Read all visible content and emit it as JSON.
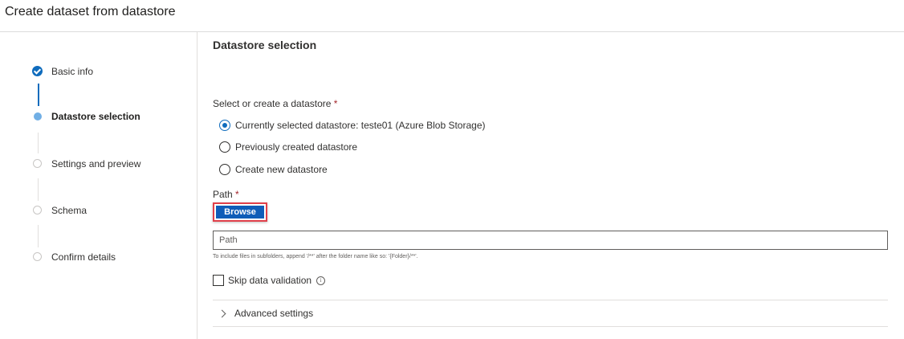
{
  "window": {
    "title": "Create dataset from datastore"
  },
  "steps": [
    {
      "label": "Basic info",
      "state": "complete"
    },
    {
      "label": "Datastore selection",
      "state": "current"
    },
    {
      "label": "Settings and preview",
      "state": "pending"
    },
    {
      "label": "Schema",
      "state": "pending"
    },
    {
      "label": "Confirm details",
      "state": "pending"
    }
  ],
  "main": {
    "section_title": "Datastore selection",
    "datastore_label": "Select or create a datastore",
    "required_mark": "*",
    "radio_options": [
      {
        "label": "Currently selected datastore: teste01 (Azure Blob Storage)",
        "selected": true
      },
      {
        "label": "Previously created datastore",
        "selected": false
      },
      {
        "label": "Create new datastore",
        "selected": false
      }
    ],
    "path_label": "Path",
    "browse_label": "Browse",
    "path_placeholder": "Path",
    "path_hint": "To include files in subfolders, append '/**' after the folder name like so: '{Folder}/**'.",
    "skip_validation_label": "Skip data validation",
    "skip_validation_checked": false,
    "info_icon": "i",
    "advanced_settings_label": "Advanced settings"
  },
  "colors": {
    "accent": "#0f6cbd",
    "required": "#a4262c",
    "highlight_border": "#e0404a"
  }
}
